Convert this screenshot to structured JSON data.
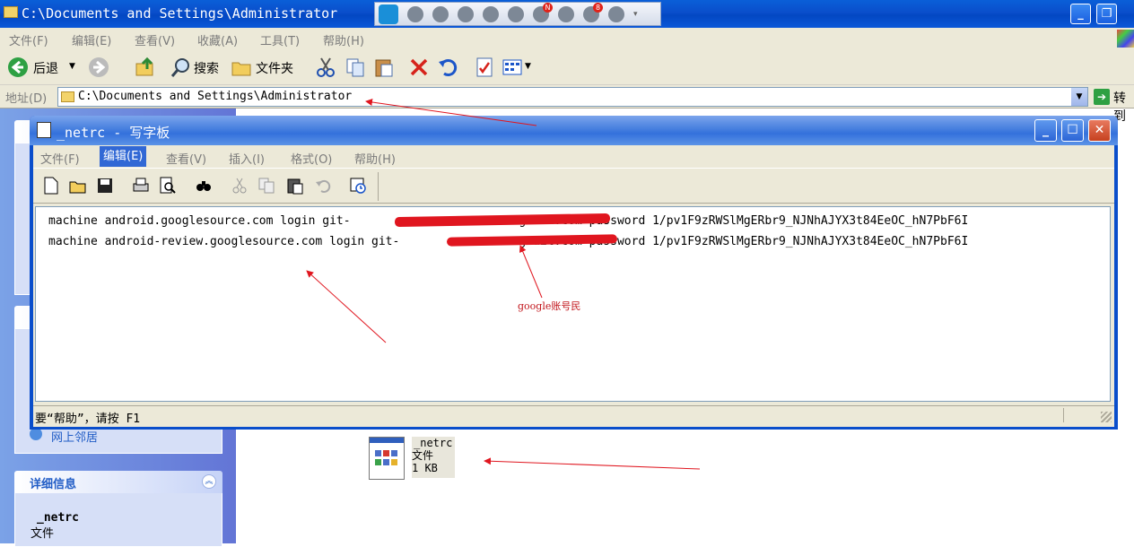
{
  "explorer": {
    "title": "C:\\Documents and Settings\\Administrator",
    "menu": [
      "文件(F)",
      "编辑(E)",
      "查看(V)",
      "收藏(A)",
      "工具(T)",
      "帮助(H)"
    ],
    "toolbar": {
      "back": "后退",
      "search": "搜索",
      "folders": "文件夹"
    },
    "address_label": "地址(D)",
    "address_value": "C:\\Documents and Settings\\Administrator",
    "go_label": "转到",
    "tray_badges": {
      "mail": "N",
      "messages": "8"
    },
    "taskpane": {
      "other_places_item": "网上邻居",
      "details_heading": "详细信息",
      "details_name": "_netrc",
      "details_type": "文件"
    },
    "file": {
      "name": "_netrc",
      "type": "文件",
      "size": "1 KB"
    }
  },
  "wordpad": {
    "title": "_netrc - 写字板",
    "menu": [
      "文件(F)",
      "编辑(E)",
      "查看(V)",
      "插入(I)",
      "格式(O)",
      "帮助(H)"
    ],
    "lines": [
      "machine android.googlesource.com login git-                     cn.gmail.com password 1/pv1F9zRWSlMgERbr9_NJNhAJYX3t84EeOC_hN7PbF6I",
      "machine android-review.googlesource.com login git-              cn.gmail.com password 1/pv1F9zRWSlMgERbr9_NJNhAJYX3t84EeOC_hN7PbF6I"
    ],
    "status": "要“帮助”，请按 F1"
  },
  "annotation": {
    "label": "google账号民",
    "color": "#e0161f"
  }
}
